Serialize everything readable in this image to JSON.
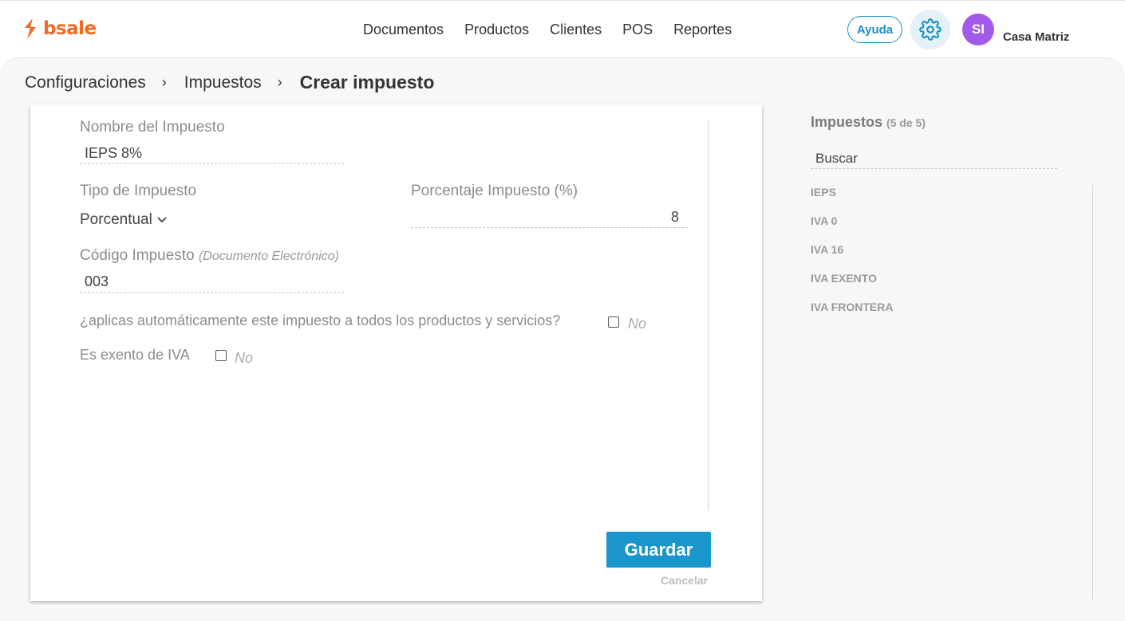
{
  "header": {
    "logo_text": "bsale",
    "nav": [
      "Documentos",
      "Productos",
      "Clientes",
      "POS",
      "Reportes"
    ],
    "help_label": "Ayuda",
    "avatar_initials": "SI",
    "branch_name": "Casa Matriz",
    "brand_color": "#f26a21",
    "accent_color": "#1a96cd",
    "avatar_color": "#a25ae8"
  },
  "breadcrumb": {
    "items": [
      "Configuraciones",
      "Impuestos"
    ],
    "current": "Crear impuesto"
  },
  "form": {
    "name_label": "Nombre del Impuesto",
    "name_value": "IEPS 8%",
    "type_label": "Tipo de Impuesto",
    "type_value": "Porcentual",
    "percent_label": "Porcentaje Impuesto (%)",
    "percent_value": "8",
    "code_label": "Código Impuesto",
    "code_note": "(Documento Electrónico)",
    "code_value": "003",
    "auto_apply_label": "¿aplicas automáticamente este impuesto a todos los productos y servicios?",
    "auto_apply_state": "No",
    "exempt_label": "Es exento de IVA",
    "exempt_state": "No",
    "save_label": "Guardar",
    "cancel_label": "Cancelar"
  },
  "sidebar": {
    "title": "Impuestos",
    "count": "(5 de 5)",
    "search_value": "Buscar",
    "items": [
      "IEPS",
      "IVA 0",
      "IVA 16",
      "IVA EXENTO",
      "IVA FRONTERA"
    ]
  }
}
